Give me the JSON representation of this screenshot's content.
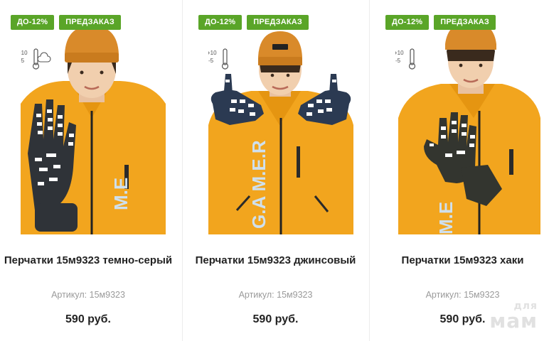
{
  "products": [
    {
      "badges": [
        "ДО-12%",
        "ПРЕДЗАКАЗ"
      ],
      "title": "Перчатки 15м9323 темно-серый",
      "sku_label": "Артикул:",
      "sku": "15м9323",
      "price": "590 руб.",
      "temp_icon": {
        "high": "+10",
        "low": "-5"
      },
      "glove_color": "#2f3338"
    },
    {
      "badges": [
        "ДО-12%",
        "ПРЕДЗАКАЗ"
      ],
      "title": "Перчатки 15м9323 джинсовый",
      "sku_label": "Артикул:",
      "sku": "15м9323",
      "price": "590 руб.",
      "temp_icon": {
        "high": "+10",
        "low": "-5"
      },
      "glove_color": "#2b3a52"
    },
    {
      "badges": [
        "ДО-12%",
        "ПРЕДЗАКАЗ"
      ],
      "title": "Перчатки 15м9323 хаки",
      "sku_label": "Артикул:",
      "sku": "15м9323",
      "price": "590 руб.",
      "temp_icon": {
        "high": "+10",
        "low": "-5"
      },
      "glove_color": "#33352f"
    }
  ],
  "watermark": {
    "line1": "для",
    "line2": "мам"
  },
  "colors": {
    "badge_green": "#5aa528",
    "jacket_yellow": "#f2a51e",
    "hat_orange": "#d98a2a"
  }
}
